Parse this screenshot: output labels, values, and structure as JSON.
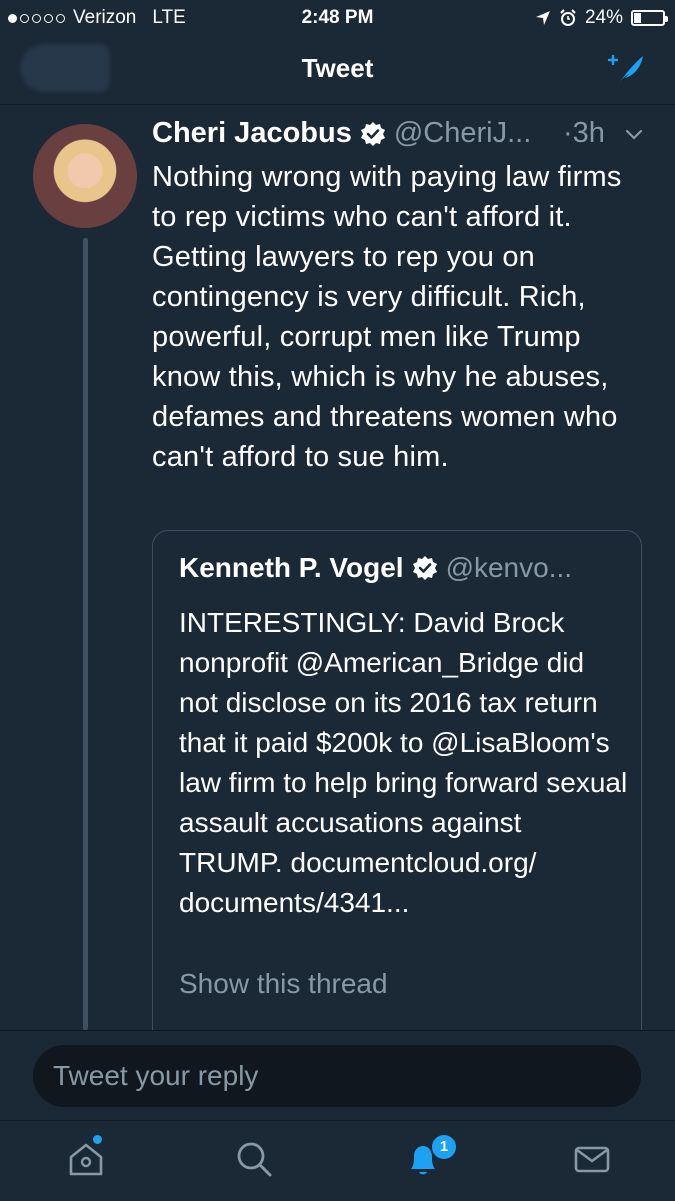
{
  "status_bar": {
    "carrier": "Verizon",
    "network": "LTE",
    "time": "2:48 PM",
    "battery": "24%",
    "battery_level": 0.24,
    "signal_bars": 1
  },
  "nav": {
    "title": "Tweet"
  },
  "tweet": {
    "author_name": "Cheri Jacobus",
    "author_handle": "@CheriJ...",
    "time_ago": "·3h",
    "text": "Nothing wrong with paying law firms to rep victims who can't afford it.  Getting lawyers to rep you on contingency is very difficult.  Rich, powerful, corrupt men like Trump know this, which is why he abuses, defames and threatens women who can't afford to sue him."
  },
  "quoted_tweet": {
    "author_name": "Kenneth P. Vogel",
    "author_handle": "@kenvo...",
    "text": "INTERESTINGLY: David Brock nonprofit @American_Bridge did not disclose on its 2016 tax return that it paid $200k to @LisaBloom's law firm to help bring forward sexual assault accusations against TRUMP. documentcloud.org/ documents/4341...",
    "show_thread": "Show this thread"
  },
  "reply": {
    "placeholder": "Tweet your reply"
  },
  "tabs": {
    "notification_count": "1",
    "icons": [
      "home-icon",
      "search-icon",
      "notifications-icon",
      "messages-icon"
    ]
  },
  "colors": {
    "background": "#1b2836",
    "accent": "#1da1f2",
    "secondary_text": "#8899a6"
  }
}
